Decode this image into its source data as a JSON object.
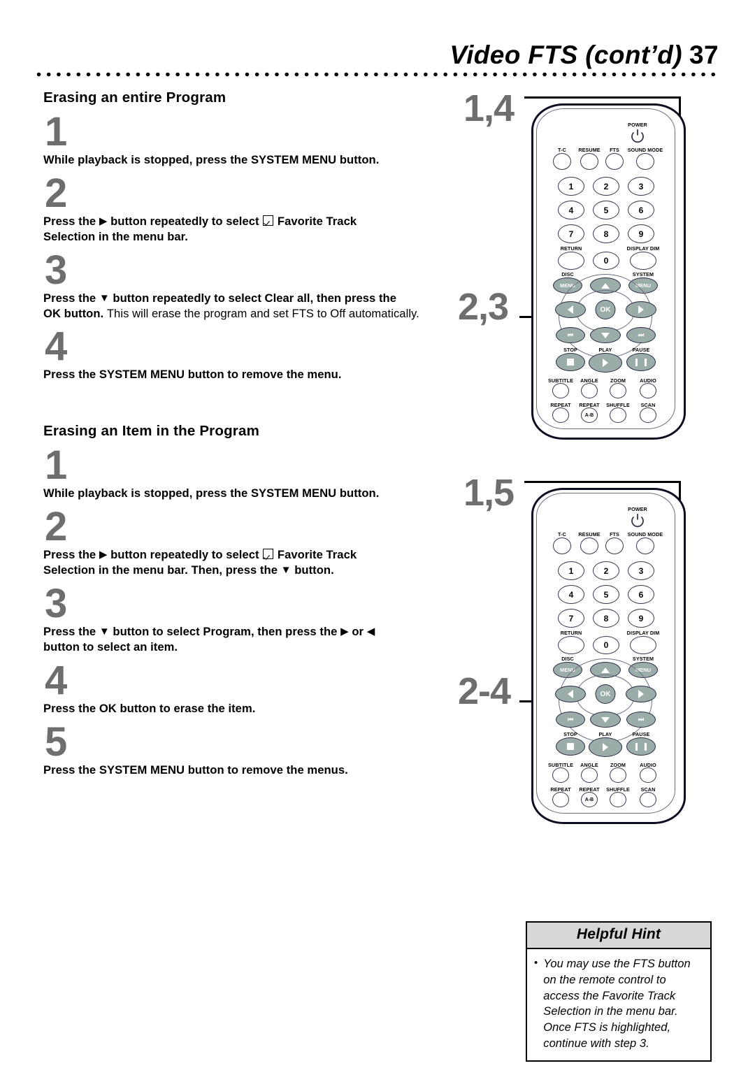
{
  "header": {
    "title": "Video FTS (cont’d)",
    "page_number": "37"
  },
  "sections": [
    {
      "title": "Erasing an entire Program",
      "steps": [
        {
          "num": "1",
          "text_lead": "While playback is stopped, press the SYSTEM MENU button."
        },
        {
          "num": "2",
          "text_lead": "Press the ▶ button repeatedly to select ☑ Favorite Track Selection in the menu bar."
        },
        {
          "num": "3",
          "text_lead": "Press the ▼ button repeatedly to select Clear all, then press the OK button.",
          "text_tail": " This will erase the program and set FTS to Off automatically."
        },
        {
          "num": "4",
          "text_lead": "Press the SYSTEM MENU button to remove the menu."
        }
      ]
    },
    {
      "title": "Erasing an Item in the Program",
      "steps": [
        {
          "num": "1",
          "text_lead": "While playback is stopped, press the SYSTEM MENU button."
        },
        {
          "num": "2",
          "text_lead": "Press the ▶ button repeatedly to select ☑ Favorite Track Selection in the menu bar. Then, press the ▼ button."
        },
        {
          "num": "3",
          "text_lead": "Press the ▼ button to select Program, then press the ▶ or ◀ button to select an item."
        },
        {
          "num": "4",
          "text_lead": "Press the OK button to erase the item."
        },
        {
          "num": "5",
          "text_lead": "Press the SYSTEM MENU button to remove the menus."
        }
      ]
    }
  ],
  "figures": [
    {
      "callout_top": "1,4",
      "callout_mid": "2,3"
    },
    {
      "callout_top": "1,5",
      "callout_mid": "2-4"
    }
  ],
  "remote": {
    "power_label": "POWER",
    "row_function": [
      "T-C",
      "RESUME",
      "FTS",
      "SOUND MODE"
    ],
    "keypad": [
      "1",
      "2",
      "3",
      "4",
      "5",
      "6",
      "7",
      "8",
      "9",
      "0"
    ],
    "return_label": "RETURN",
    "display_dim_label": "DISPLAY DIM",
    "disc_label": "DISC",
    "system_label": "SYSTEM",
    "menu_label": "MENU",
    "ok_label": "OK",
    "transport_labels": [
      "STOP",
      "PLAY",
      "PAUSE"
    ],
    "row_subtitle": [
      "SUBTITLE",
      "ANGLE",
      "ZOOM",
      "AUDIO"
    ],
    "row_repeat": [
      "REPEAT",
      "REPEAT",
      "SHUFFLE",
      "SCAN"
    ],
    "repeat_ab_label": "A-B"
  },
  "hint": {
    "heading": "Helpful Hint",
    "bullet": "•",
    "text": "You may use the FTS button on the remote control to access the Favorite Track Selection in the menu bar. Once FTS is highlighted, continue with step 3."
  },
  "colors": {
    "step_number_gray": "#6e6e6e",
    "button_fill": "#9aada8",
    "outline_navy": "#2a2a44",
    "hint_header_gray": "#d7d7d7"
  }
}
